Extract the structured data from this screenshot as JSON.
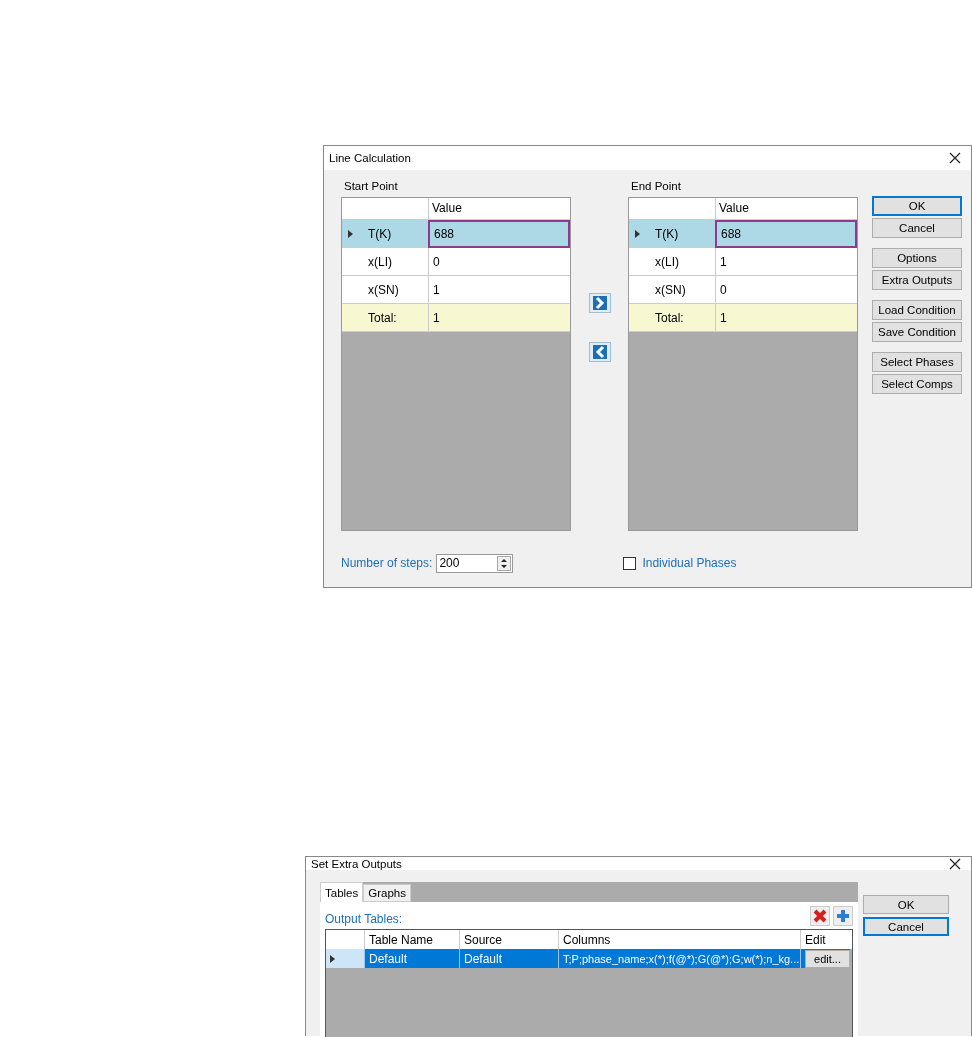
{
  "line_calculation": {
    "title": "Line Calculation",
    "start_point": {
      "label": "Start Point",
      "header": "Value",
      "rows": [
        {
          "name": "T(K)",
          "value": "688",
          "kind": "value",
          "selected": true
        },
        {
          "name": "x(LI)",
          "value": "0",
          "kind": "value",
          "selected": false
        },
        {
          "name": "x(SN)",
          "value": "1",
          "kind": "value",
          "selected": false
        },
        {
          "name": "Total:",
          "value": "1",
          "kind": "total",
          "selected": false
        }
      ]
    },
    "end_point": {
      "label": "End Point",
      "header": "Value",
      "rows": [
        {
          "name": "T(K)",
          "value": "688",
          "kind": "value",
          "selected": true
        },
        {
          "name": "x(LI)",
          "value": "1",
          "kind": "value",
          "selected": false
        },
        {
          "name": "x(SN)",
          "value": "0",
          "kind": "value",
          "selected": false
        },
        {
          "name": "Total:",
          "value": "1",
          "kind": "total",
          "selected": false
        }
      ]
    },
    "button_groups": [
      [
        {
          "label": "OK",
          "focused": true
        },
        {
          "label": "Cancel",
          "focused": false
        }
      ],
      [
        {
          "label": "Options",
          "focused": false
        },
        {
          "label": "Extra Outputs",
          "focused": false
        }
      ],
      [
        {
          "label": "Load Condition",
          "focused": false
        },
        {
          "label": "Save Condition",
          "focused": false
        }
      ],
      [
        {
          "label": "Select Phases",
          "focused": false
        },
        {
          "label": "Select Comps",
          "focused": false
        }
      ]
    ],
    "steps_label": "Number of steps:",
    "steps_value": "200",
    "individual_phases": {
      "label": "Individual Phases",
      "checked": false
    }
  },
  "extra_outputs": {
    "title": "Set Extra Outputs",
    "tabs": [
      {
        "label": "Tables",
        "selected": true
      },
      {
        "label": "Graphs",
        "selected": false
      }
    ],
    "output_tables_label": "Output Tables:",
    "columns": [
      "Table Name",
      "Source",
      "Columns",
      "Edit"
    ],
    "rows": [
      {
        "table_name": "Default",
        "source": "Default",
        "columns": "T;P;phase_name;x(*);f(@*);G(@*);G;w(*);n_kg...",
        "edit": "edit...",
        "selected": true
      }
    ],
    "buttons": [
      {
        "label": "OK",
        "focused": false
      },
      {
        "label": "Cancel",
        "focused": true
      }
    ]
  }
}
